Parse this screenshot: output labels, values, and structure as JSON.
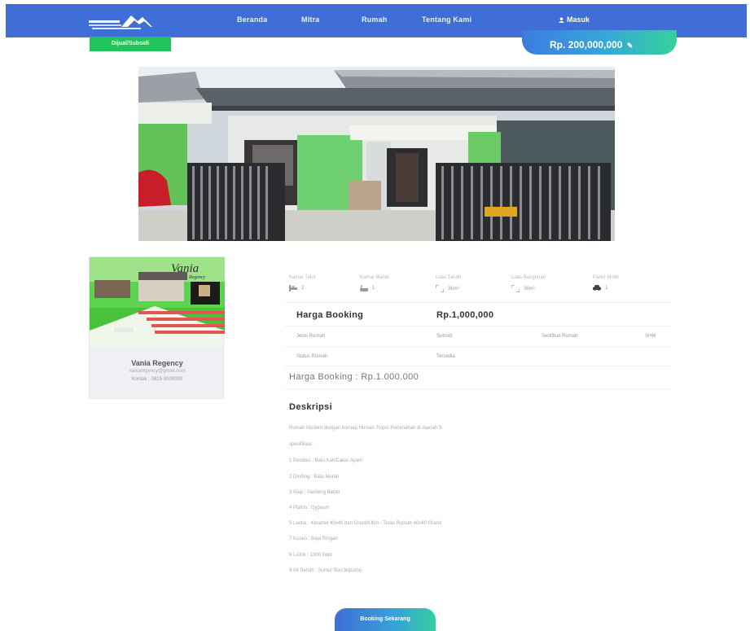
{
  "nav": {
    "items": [
      "Beranda",
      "Mitra",
      "Rumah",
      "Tentang Kami"
    ],
    "login_label": "Masuk",
    "brand_color": "#3f6fd6"
  },
  "listing": {
    "status_badge": "Dijual/Subsidi",
    "price": "Rp. 200,000,000",
    "specs": [
      {
        "label": "Kamar Tidur",
        "value": "2",
        "icon": "bed-icon"
      },
      {
        "label": "Kamar Mandi",
        "value": "1",
        "icon": "bath-icon"
      },
      {
        "label": "Luas Tanah",
        "value": "36m²",
        "icon": "land-area-icon"
      },
      {
        "label": "Luas Bangunan",
        "value": "36m²",
        "icon": "building-area-icon"
      },
      {
        "label": "Parkir Mobil",
        "value": "1",
        "icon": "car-icon"
      }
    ],
    "booking_label": "Harga Booking",
    "booking_value": "Rp.1,000,000",
    "details": {
      "type_label": "Jenis Rumah",
      "type_value": "Subsidi",
      "certificate_label": "Sertifikat Rumah",
      "certificate_value": "SHM",
      "status_label": "Status Rumah",
      "status_value": "Tersedia"
    },
    "booking_line": "Harga Booking : Rp.1.000.000"
  },
  "description": {
    "title": "Deskripsi",
    "lines": [
      "Rumah Modern dengan konsep Hunian Tropis Perumahan di daerah S",
      "spesifikasi :",
      "1 Pondasi : Batu Kali/Cakar Ayam",
      "2 Dinding : Bata Merah",
      "3 Atap : Genteng Beton",
      "4 Plafon : Gypsum",
      "5 Lantai : Keramik 40x40 dan Granit/Ubin - Teras Rumah 40x40 Granit",
      "7 Kusen : Baja Ringan",
      "8 Listrik : 1300 Watt",
      "9 Air Bersih : Sumur Bor/Jetpump"
    ]
  },
  "agent": {
    "name": "Vania Regency",
    "email": "vaniaregency@gmail.com",
    "phone": "Kontak : 0815-0000000",
    "banner_title": "Vania",
    "banner_subtitle": "Regency"
  },
  "cta": {
    "label": "Booking Sekarang"
  }
}
